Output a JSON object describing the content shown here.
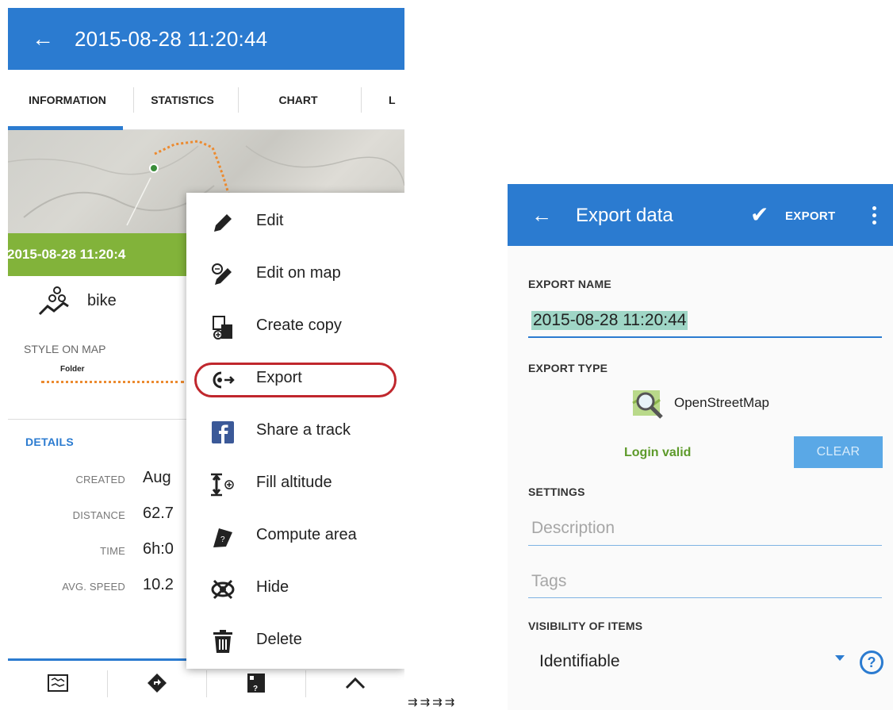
{
  "left_screen": {
    "app_bar": {
      "back_icon": "arrow-left-icon",
      "title": "2015-08-28 11:20:44"
    },
    "tabs": [
      {
        "label": "INFORMATION",
        "active": true
      },
      {
        "label": "STATISTICS",
        "active": false
      },
      {
        "label": "CHART",
        "active": false
      },
      {
        "label": "L",
        "active": false
      }
    ],
    "green_bar": {
      "title": "2015-08-28 11:20:4"
    },
    "activity": {
      "icon": "bike-icon",
      "label": "bike"
    },
    "style_on_map": {
      "label": "STYLE ON MAP",
      "folder": "Folder"
    },
    "details": {
      "title": "DETAILS",
      "rows": [
        {
          "key": "CREATED",
          "value": "Aug"
        },
        {
          "key": "DISTANCE",
          "value": "62.7"
        },
        {
          "key": "TIME",
          "value": "6h:0"
        },
        {
          "key": "AVG. SPEED",
          "value": "10.2"
        }
      ]
    },
    "bottom_bar": [
      "map-icon",
      "navigation-icon",
      "tools-icon",
      "chevron-up-icon"
    ],
    "menu": [
      {
        "label": "Edit",
        "icon": "pencil-icon"
      },
      {
        "label": "Edit on map",
        "icon": "edit-on-map-icon"
      },
      {
        "label": "Create copy",
        "icon": "copy-icon"
      },
      {
        "label": "Export",
        "icon": "export-icon",
        "highlighted": true
      },
      {
        "label": "Share a track",
        "icon": "facebook-icon"
      },
      {
        "label": "Fill altitude",
        "icon": "altitude-icon"
      },
      {
        "label": "Compute area",
        "icon": "area-icon"
      },
      {
        "label": "Hide",
        "icon": "hide-icon"
      },
      {
        "label": "Delete",
        "icon": "trash-icon"
      }
    ]
  },
  "arrows": "⇉⇉⇉⇉",
  "right_screen": {
    "app_bar": {
      "back_icon": "arrow-left-icon",
      "title": "Export data",
      "action_label": "EXPORT",
      "check_icon": "check-icon",
      "more_icon": "more-vert-icon"
    },
    "export_name": {
      "label": "EXPORT NAME",
      "value": "2015-08-28 11:20:44"
    },
    "export_type": {
      "label": "EXPORT TYPE",
      "service": "OpenStreetMap",
      "service_icon": "osm-icon"
    },
    "login": {
      "status": "Login valid",
      "clear_label": "CLEAR"
    },
    "settings": {
      "label": "SETTINGS",
      "description_placeholder": "Description",
      "tags_placeholder": "Tags"
    },
    "visibility": {
      "label": "VISIBILITY OF ITEMS",
      "value": "Identifiable",
      "help_icon": "help-icon"
    }
  },
  "colors": {
    "primary": "#2b7bd0",
    "green_bar": "#82b33a",
    "login_valid": "#5d9a2a",
    "export_highlight": "#c0272d",
    "track": "#ec8a2f"
  }
}
